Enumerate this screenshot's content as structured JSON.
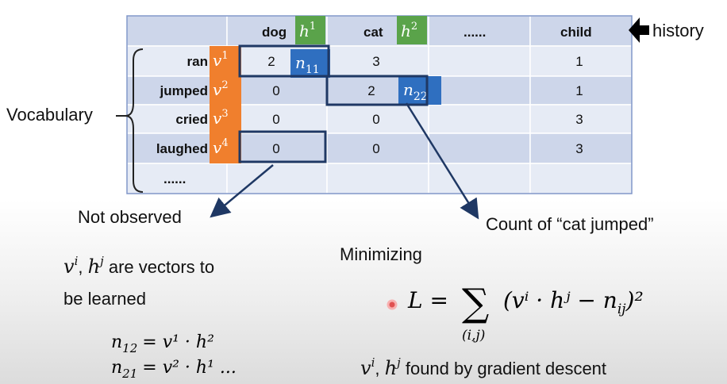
{
  "table": {
    "columns": [
      "dog",
      "cat",
      "......",
      "child"
    ],
    "rows": [
      {
        "word": "ran",
        "tag": "v",
        "sup": "1",
        "cells": [
          "2",
          "3",
          "",
          "1"
        ]
      },
      {
        "word": "jumped",
        "tag": "v",
        "sup": "2",
        "cells": [
          "0",
          "2",
          "",
          "1"
        ]
      },
      {
        "word": "cried",
        "tag": "v",
        "sup": "3",
        "cells": [
          "0",
          "0",
          "",
          "3"
        ]
      },
      {
        "word": "laughed",
        "tag": "v",
        "sup": "4",
        "cells": [
          "0",
          "0",
          "",
          "3"
        ]
      },
      {
        "word": "......",
        "tag": "",
        "sup": "",
        "cells": [
          "",
          "",
          "",
          ""
        ]
      }
    ],
    "col_tags": [
      {
        "letter": "h",
        "sup": "1"
      },
      {
        "letter": "h",
        "sup": "2"
      }
    ],
    "n11": {
      "base": "n",
      "sub": "11"
    },
    "n22": {
      "base": "n",
      "sub": "22"
    }
  },
  "labels": {
    "history": "history",
    "vocabulary": "Vocabulary",
    "not_observed": "Not observed",
    "count_of": "Count of “cat jumped”",
    "minimizing": "Minimizing",
    "vectors_line1_tail": " are vectors to",
    "vectors_line2": "be learned",
    "found_tail": " found by gradient descent"
  },
  "math": {
    "vi": "v",
    "vi_sup": "i",
    "hj": "h",
    "hj_sup": "j",
    "eq1": {
      "lhs": "n",
      "lhs_sub": "12",
      "rhs": "= v¹ · h²"
    },
    "eq2": {
      "lhs": "n",
      "lhs_sub": "21",
      "rhs": "= v² · h¹ ..."
    },
    "loss": {
      "L": "L = ",
      "sum": "∑",
      "sum_sub": "(i,j)",
      "body": "(vⁱ · hʲ − n",
      "body_sub": "ij",
      "close": ")²"
    }
  },
  "colors": {
    "table_fill_dark": "#cdd6ea",
    "table_fill_light": "#e6ebf5",
    "table_border": "#ffffff",
    "outer_border": "#7f95c8",
    "orange_tag": "#f07f2d",
    "green_tag": "#5aa34a",
    "blue_tag": "#2f6fc0",
    "arrow": "#1f3864"
  }
}
